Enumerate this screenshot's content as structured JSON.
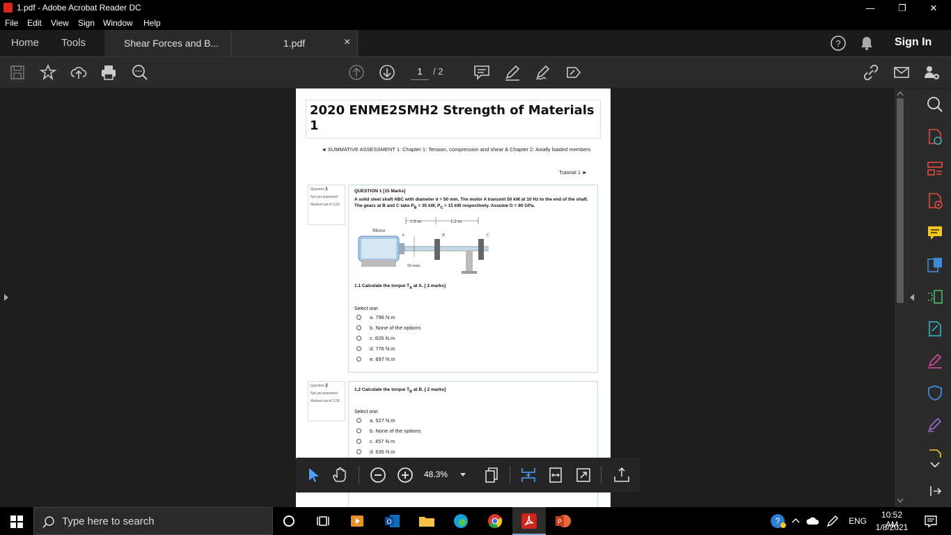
{
  "window": {
    "title": "1.pdf - Adobe Acrobat Reader DC",
    "minimize": "—",
    "restore": "❐",
    "close": "✕"
  },
  "menu": [
    "File",
    "Edit",
    "View",
    "Sign",
    "Window",
    "Help"
  ],
  "tabs": {
    "home": "Home",
    "tools": "Tools",
    "docs": [
      {
        "label": "Shear Forces and B..."
      },
      {
        "label": "1.pdf",
        "close": "×"
      }
    ],
    "sign_in": "Sign In"
  },
  "pagenav": {
    "current": "1",
    "total": "/ 2"
  },
  "zoom": {
    "value": "48.3%"
  },
  "document": {
    "title": "2020 ENME2SMH2 Strength of Materials 1",
    "breadcrumb": "◄ SUMMATIVE ASSESSMENT 1: Chapter 1: Tension, compression and shear & Chapter 2: Axially loaded members",
    "next_link": "Tutorial 1 ►",
    "q1": {
      "label": "Question",
      "num": "1",
      "status": "Not yet answered",
      "marked": "Marked out of 2,00",
      "heading": "QUESTION 1 [15 Marks]",
      "text": "A solid steel shaft ABC with diameter d = 50 mm. The motor A transmit 50 kW at 10 Hz to the end of the shaft. The gears at B and C take P",
      "text_b": "B",
      "text_mid": " = 35 kW, P",
      "text_c": "C",
      "text_end": " = 15 kW respectively. Assume G = 80 GPa.",
      "figure": {
        "motor": "Motor",
        "dim1": "1.0 m",
        "dim2": "1.2 m",
        "diam": "50 mm",
        "a": "A",
        "b": "B",
        "c": "C"
      },
      "sub": "1.1  Calculate the torque T",
      "sub_s": "A",
      "sub_e": " at A. [ 2 marks]",
      "select": "Select one:",
      "options": [
        "a. 796 N.m",
        "b. None of the options",
        "c. 826 N.m",
        "d. 776 N.m",
        "e. 697 N.m"
      ]
    },
    "q2": {
      "label": "Question",
      "num": "2",
      "status": "Not yet answered",
      "marked": "Marked out of 2,00",
      "sub": "1.2  Calculate the torque T",
      "sub_s": "B",
      "sub_e": " at B. [ 2 marks]",
      "select": "Select one:",
      "options": [
        "a. 527 N.m",
        "b. None of the options",
        "c. 457 N.m",
        "d. 636 N.m"
      ]
    }
  },
  "taskbar": {
    "search_placeholder": "Type here to search",
    "lang": "ENG",
    "time": "10:52 AM",
    "date": "1/8/2021"
  }
}
